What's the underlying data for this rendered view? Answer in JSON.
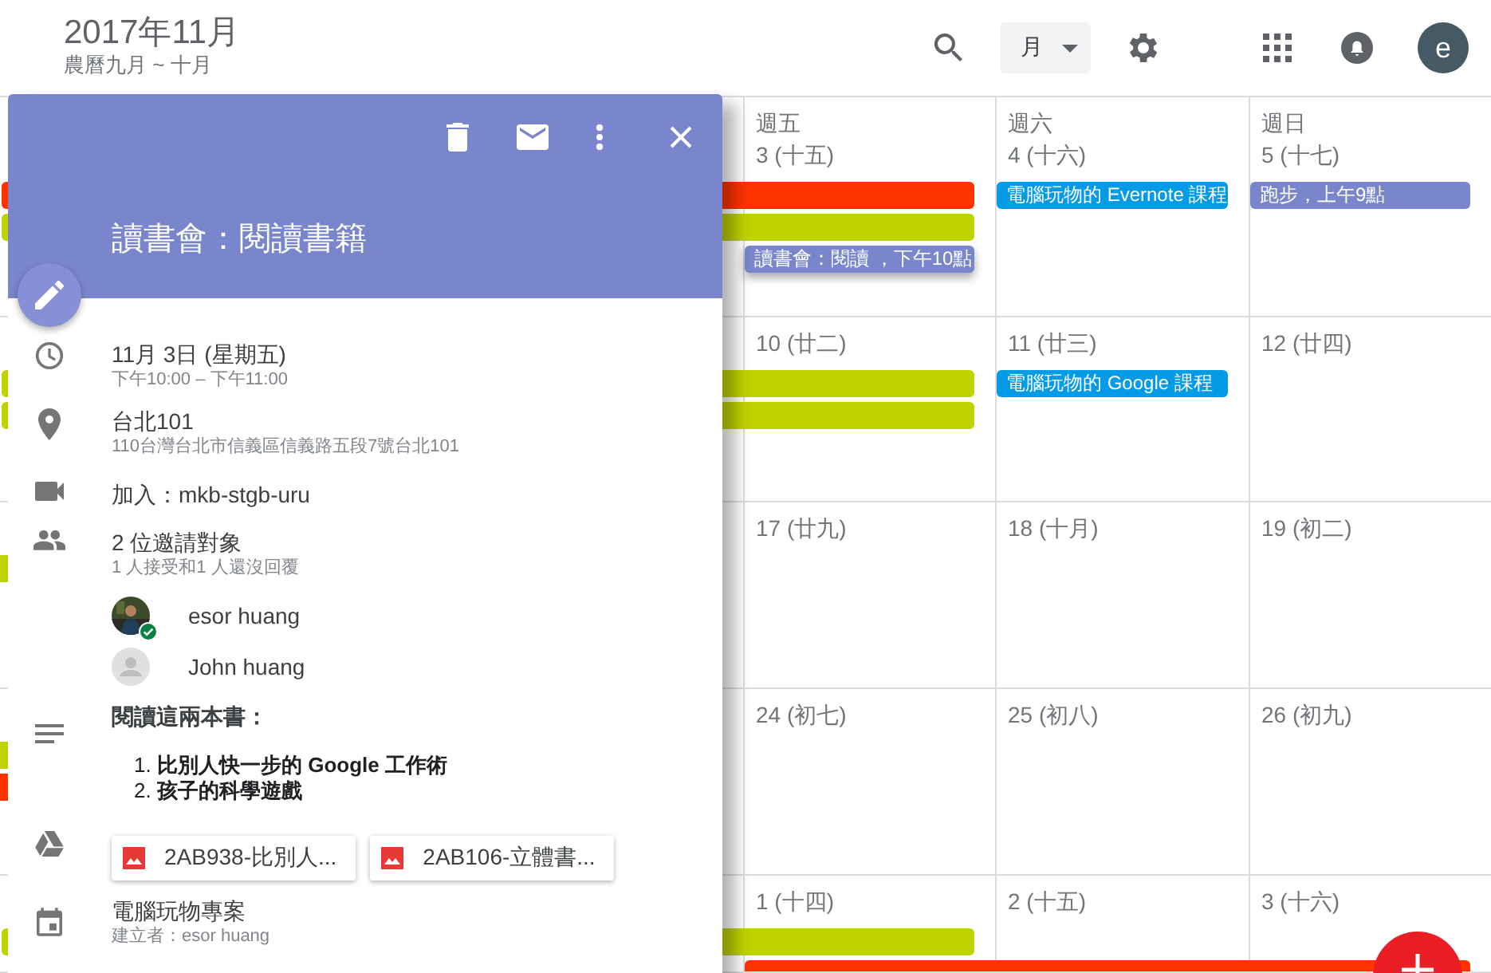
{
  "header": {
    "title": "2017年11月",
    "subtitle": "農曆九月 ~ 十月",
    "view": "月",
    "avatar": "e"
  },
  "weeks": [
    {
      "days": [
        {
          "weekday": "週五",
          "date": "3 (十五)"
        },
        {
          "weekday": "週六",
          "date": "4 (十六)"
        },
        {
          "weekday": "週日",
          "date": "5 (十七)"
        }
      ],
      "events": [
        {
          "kind": "continued",
          "color": "#ff3300",
          "selected": false
        },
        {
          "kind": "continued",
          "color": "#bfd300",
          "selected": false
        },
        {
          "kind": "friday",
          "color": "#7986cb",
          "title": "讀書會：閱讀 ，下午10點",
          "selected": true
        },
        {
          "kind": "saturday",
          "color": "#039be5",
          "title": "電腦玩物的 Evernote 課程",
          "selected": false
        },
        {
          "kind": "sunday",
          "color": "#7986cb",
          "title": "跑步，上午9點",
          "selected": false
        }
      ]
    },
    {
      "days": [
        {
          "date": "10 (廿二)"
        },
        {
          "date": "11 (廿三)"
        },
        {
          "date": "12 (廿四)"
        }
      ],
      "events": [
        {
          "kind": "continued",
          "color": "#bfd300",
          "selected": false
        },
        {
          "kind": "continued",
          "color": "#bfd300",
          "selected": false
        },
        {
          "kind": "saturday",
          "color": "#039be5",
          "title": "電腦玩物的 Google 課程",
          "selected": false
        }
      ]
    },
    {
      "days": [
        {
          "date": "17 (廿九)"
        },
        {
          "date": "18 (十月)"
        },
        {
          "date": "19 (初二)"
        }
      ],
      "events": [
        {
          "kind": "edge",
          "color": "#bfd300",
          "selected": false
        }
      ]
    },
    {
      "days": [
        {
          "date": "24 (初七)"
        },
        {
          "date": "25 (初八)"
        },
        {
          "date": "26 (初九)"
        }
      ],
      "events": [
        {
          "kind": "edge",
          "color": "#bfd300",
          "selected": false
        },
        {
          "kind": "edge",
          "color": "#ff3300",
          "selected": false
        }
      ]
    },
    {
      "days": [
        {
          "date": "1 (十四)"
        },
        {
          "date": "2 (十五)"
        },
        {
          "date": "3 (十六)"
        }
      ],
      "events": [
        {
          "kind": "continued",
          "color": "#bfd300",
          "selected": false
        },
        {
          "kind": "through",
          "color": "#ff3300",
          "selected": false
        }
      ]
    }
  ],
  "popup": {
    "title": "讀書會：閱讀書籍",
    "details": [
      {
        "kind": "time",
        "primary": "11月 3日 (星期五)",
        "secondary": "下午10:00 – 下午11:00"
      },
      {
        "kind": "location",
        "primary": "台北101",
        "secondary": "110台灣台北市信義區信義路五段7號台北101"
      },
      {
        "kind": "video",
        "primary": "加入：mkb-stgb-uru"
      },
      {
        "kind": "guests",
        "primary": "2 位邀請對象",
        "secondary": "1 人接受和1 人還沒回覆",
        "guests": [
          {
            "name": "esor huang",
            "photo": true,
            "accepted": true
          },
          {
            "name": "John huang",
            "photo": false,
            "accepted": false
          }
        ]
      },
      {
        "kind": "notes",
        "primary": "閱讀這兩本書：",
        "items": [
          "1. **比別人快一步的 Google 工作術**",
          "2. **孩子的科學遊戲**"
        ]
      },
      {
        "kind": "attachments",
        "files": [
          "2AB938-比別人...",
          "2AB106-立體書..."
        ]
      },
      {
        "kind": "calendar",
        "primary": "電腦玩物專案",
        "secondary": "建立者：esor huang"
      }
    ]
  }
}
